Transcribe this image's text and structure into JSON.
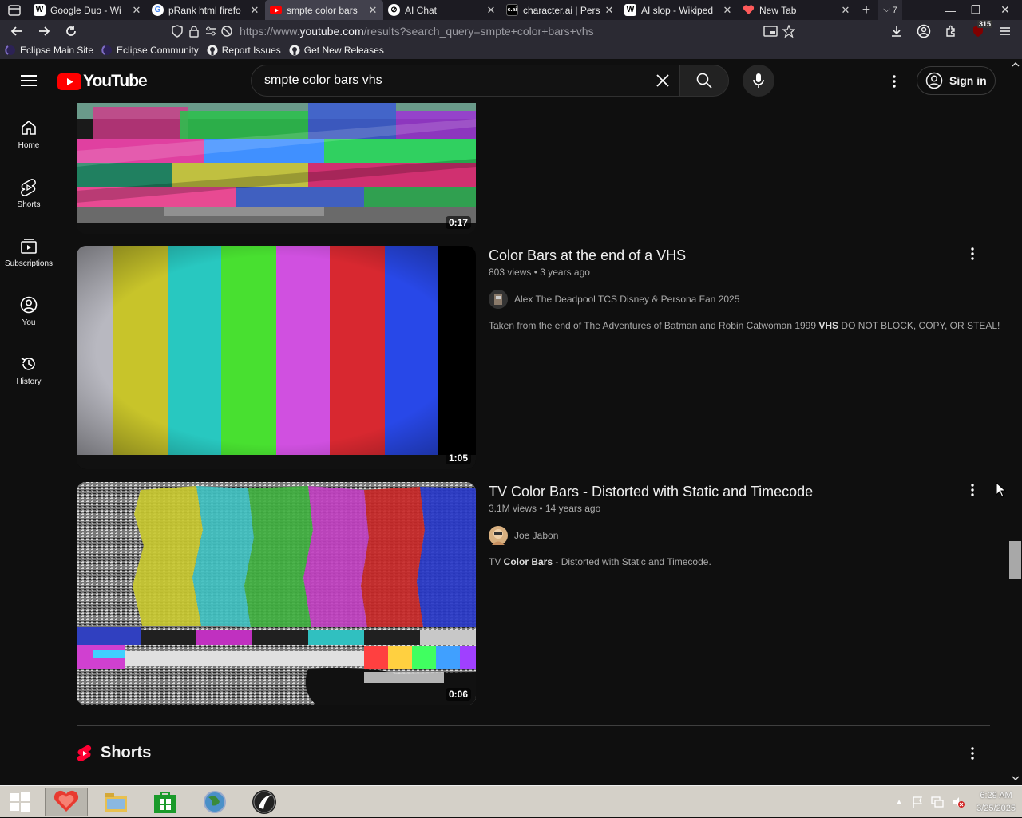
{
  "browser": {
    "tabs": [
      {
        "label": "Google Duo - Wi",
        "icon": "wikipedia-icon",
        "active": false
      },
      {
        "label": "pRank html firefo",
        "icon": "google-icon",
        "active": false
      },
      {
        "label": "smpte color bars",
        "icon": "youtube-icon",
        "active": true
      },
      {
        "label": "AI Chat",
        "icon": "chat-icon",
        "active": false
      },
      {
        "label": "character.ai | Pers",
        "icon": "characterai-icon",
        "active": false
      },
      {
        "label": "AI slop - Wikiped",
        "icon": "wikipedia-icon",
        "active": false
      },
      {
        "label": "New Tab",
        "icon": "newtab-icon",
        "active": false
      }
    ],
    "tab_count": "7",
    "url_prefix": "https://www.",
    "url_domain": "youtube.com",
    "url_path": "/results?search_query=smpte+color+bars+vhs",
    "notification_badge": "315",
    "bookmarks": [
      {
        "label": "Eclipse Main Site"
      },
      {
        "label": "Eclipse Community"
      },
      {
        "label": "Report Issues"
      },
      {
        "label": "Get New Releases"
      }
    ]
  },
  "youtube": {
    "logo_text": "YouTube",
    "search_query": "smpte color bars vhs",
    "sign_in_label": "Sign in",
    "guide": [
      {
        "label": "Home",
        "icon": "home-icon"
      },
      {
        "label": "Shorts",
        "icon": "shorts-icon"
      },
      {
        "label": "Subscriptions",
        "icon": "subscriptions-icon"
      },
      {
        "label": "You",
        "icon": "you-icon"
      },
      {
        "label": "History",
        "icon": "history-icon"
      }
    ],
    "videos": [
      {
        "duration": "0:17"
      },
      {
        "title": "Color Bars at the end of a VHS",
        "meta": "803 views • 3 years ago",
        "channel": "Alex The Deadpool TCS Disney & Persona Fan 2025",
        "desc_pre": "Taken from the end of The Adventures of Batman and Robin Catwoman 1999 ",
        "desc_bold": "VHS",
        "desc_post": " DO NOT BLOCK, COPY, OR STEAL!",
        "duration": "1:05"
      },
      {
        "title": "TV Color Bars - Distorted with Static and Timecode",
        "meta": "3.1M views • 14 years ago",
        "channel": "Joe Jabon",
        "desc_pre": "TV ",
        "desc_bold": "Color Bars",
        "desc_post": " - Distorted with Static and Timecode.",
        "duration": "0:06"
      }
    ],
    "shorts_title": "Shorts"
  },
  "taskbar": {
    "time": "6:29 AM",
    "date": "3/25/2025"
  },
  "colors": {
    "yt_red": "#ff0000",
    "bg": "#0f0f0f"
  }
}
